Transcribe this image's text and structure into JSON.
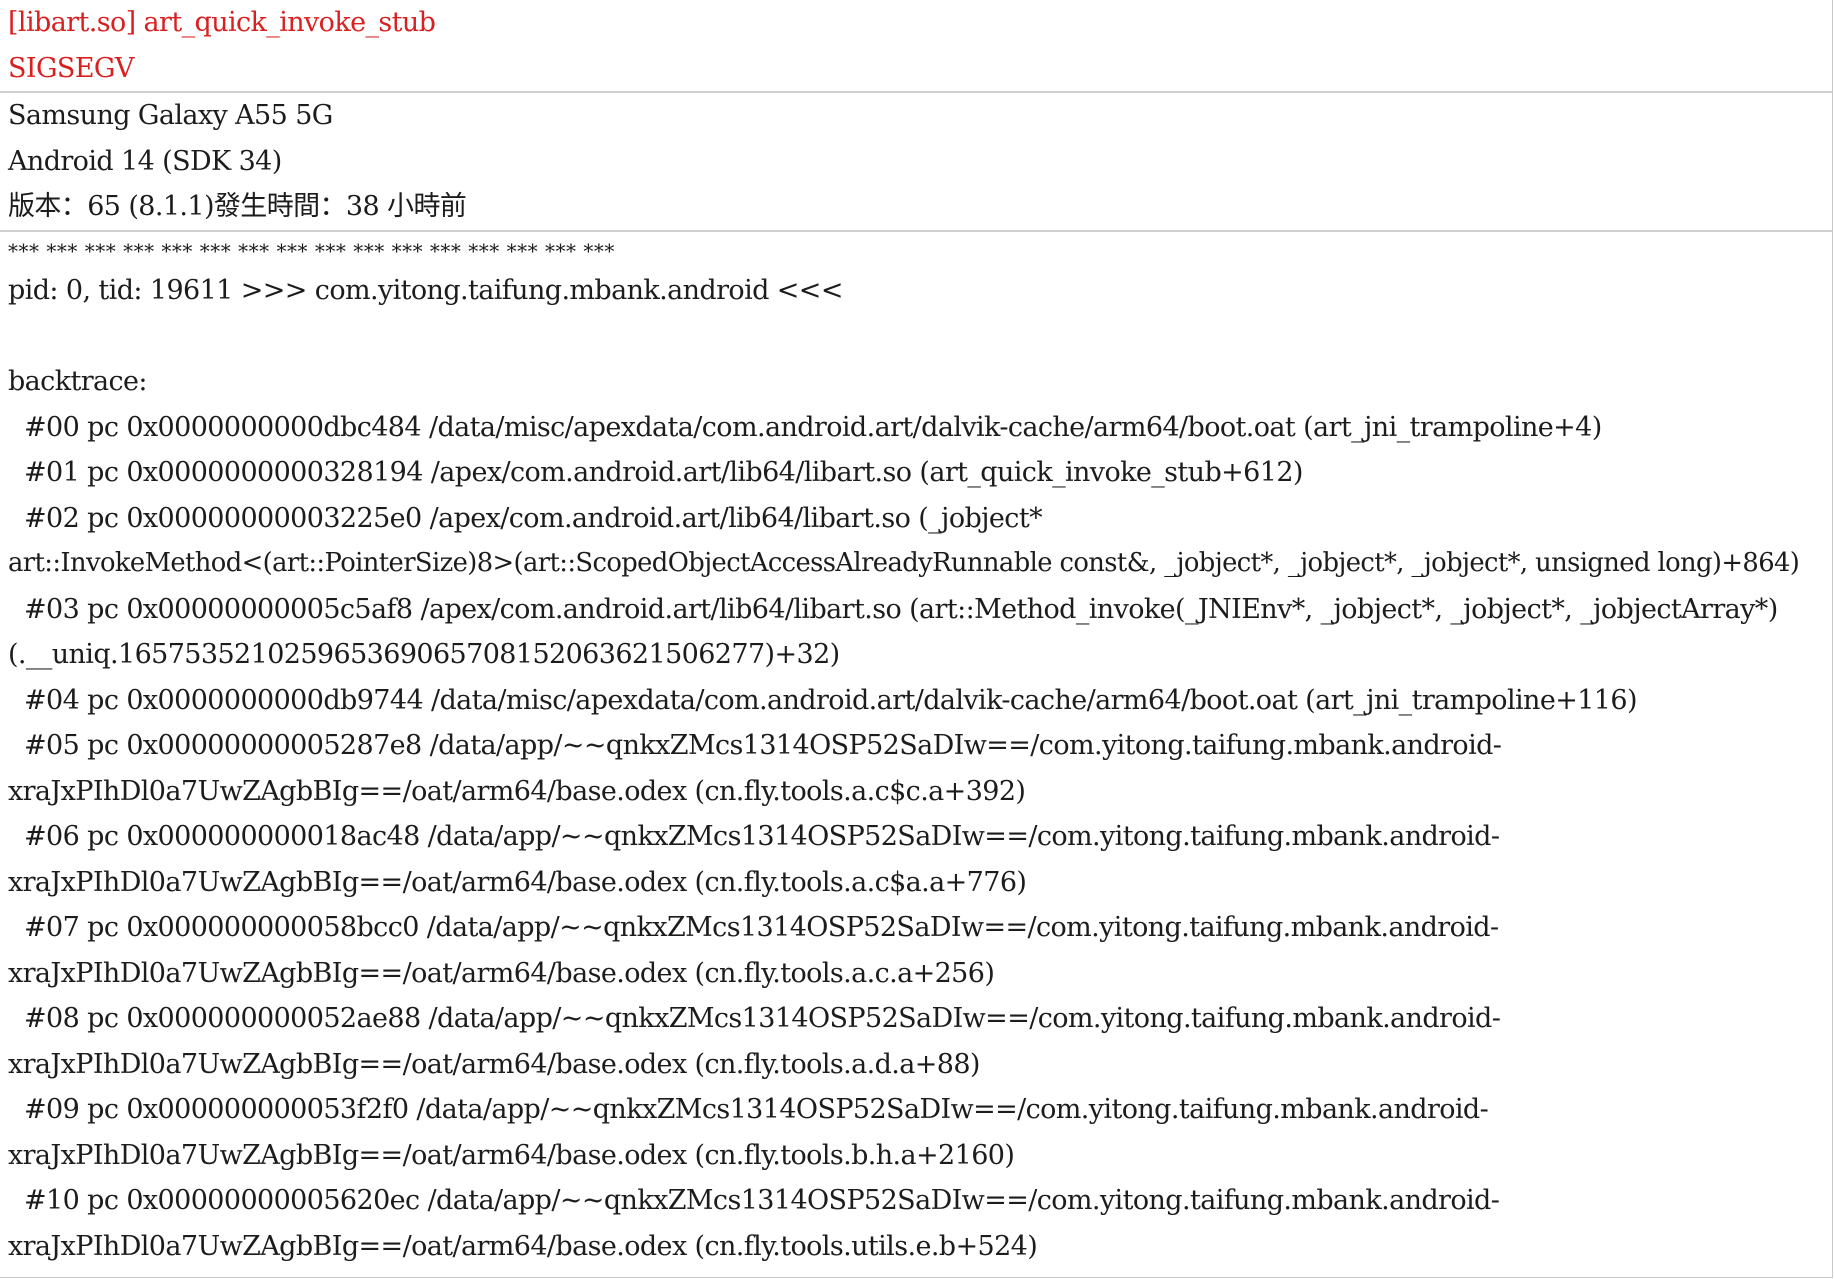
{
  "header": {
    "title": "[libart.so] art_quick_invoke_stub",
    "signal": "SIGSEGV"
  },
  "device": {
    "model": "Samsung Galaxy A55 5G",
    "os": "Android 14 (SDK 34)",
    "version_line": "版本：65 (8.1.1)發生時間：38 小時前"
  },
  "log": {
    "separator": "*** *** *** *** *** *** *** *** *** *** *** *** *** *** *** ***",
    "process_line": "pid: 0, tid: 19611 >>> com.yitong.taifung.mbank.android <<<",
    "backtrace_label": "backtrace:",
    "frames": [
      {
        "line1": "#00   pc 0x0000000000dbc484   /data/misc/apexdata/com.android.art/dalvik-cache/arm64/boot.oat (art_jni_trampoline+4)",
        "line2": ""
      },
      {
        "line1": "#01   pc 0x0000000000328194   /apex/com.android.art/lib64/libart.so (art_quick_invoke_stub+612)",
        "line2": ""
      },
      {
        "line1": "#02   pc 0x00000000003225e0   /apex/com.android.art/lib64/libart.so (_jobject*",
        "line2": "art::InvokeMethod<(art::PointerSize)8>(art::ScopedObjectAccessAlreadyRunnable const&, _jobject*, _jobject*, _jobject*, unsigned long)+864)"
      },
      {
        "line1": "#03   pc 0x00000000005c5af8   /apex/com.android.art/lib64/libart.so (art::Method_invoke(_JNIEnv*, _jobject*, _jobject*, _jobjectArray*)",
        "line2": "(.__uniq.165753521025965369065708152063621506277)+32)"
      },
      {
        "line1": "#04   pc 0x0000000000db9744   /data/misc/apexdata/com.android.art/dalvik-cache/arm64/boot.oat (art_jni_trampoline+116)",
        "line2": ""
      },
      {
        "line1": "#05   pc 0x00000000005287e8   /data/app/~~qnkxZMcs1314OSP52SaDIw==/com.yitong.taifung.mbank.android-",
        "line2": "xraJxPIhDl0a7UwZAgbBIg==/oat/arm64/base.odex (cn.fly.tools.a.c$c.a+392)"
      },
      {
        "line1": "#06   pc 0x000000000018ac48   /data/app/~~qnkxZMcs1314OSP52SaDIw==/com.yitong.taifung.mbank.android-",
        "line2": "xraJxPIhDl0a7UwZAgbBIg==/oat/arm64/base.odex (cn.fly.tools.a.c$a.a+776)"
      },
      {
        "line1": "#07   pc 0x000000000058bcc0   /data/app/~~qnkxZMcs1314OSP52SaDIw==/com.yitong.taifung.mbank.android-",
        "line2": "xraJxPIhDl0a7UwZAgbBIg==/oat/arm64/base.odex (cn.fly.tools.a.c.a+256)"
      },
      {
        "line1": "#08   pc 0x000000000052ae88   /data/app/~~qnkxZMcs1314OSP52SaDIw==/com.yitong.taifung.mbank.android-",
        "line2": "xraJxPIhDl0a7UwZAgbBIg==/oat/arm64/base.odex (cn.fly.tools.a.d.a+88)"
      },
      {
        "line1": "#09   pc 0x000000000053f2f0   /data/app/~~qnkxZMcs1314OSP52SaDIw==/com.yitong.taifung.mbank.android-",
        "line2": "xraJxPIhDl0a7UwZAgbBIg==/oat/arm64/base.odex (cn.fly.tools.b.h.a+2160)"
      },
      {
        "line1": "#10   pc 0x00000000005620ec   /data/app/~~qnkxZMcs1314OSP52SaDIw==/com.yitong.taifung.mbank.android-",
        "line2": "xraJxPIhDl0a7UwZAgbBIg==/oat/arm64/base.odex (cn.fly.tools.utils.e.b+524)"
      }
    ]
  }
}
